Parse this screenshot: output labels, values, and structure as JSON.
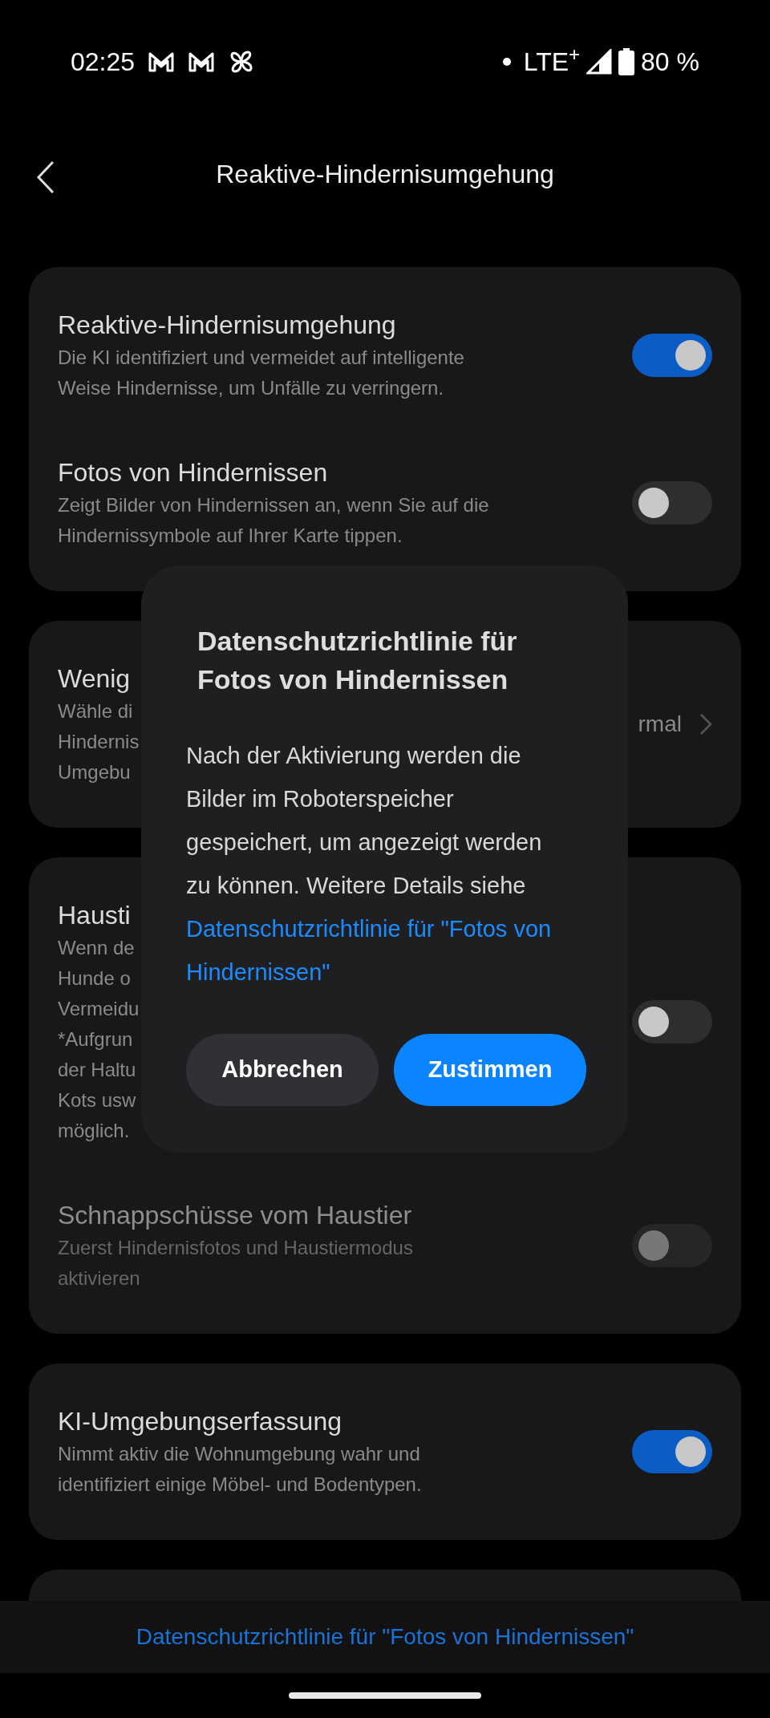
{
  "status_bar": {
    "time": "02:25",
    "network": "LTE$^{+}$",
    "battery": "80 %"
  },
  "header": {
    "title": "Reaktive-Hindernisumgehung"
  },
  "cards": [
    {
      "rows": [
        {
          "kind": "toggle",
          "title": "Reaktive-Hindernisumgehung",
          "description_lines": [
            "Die KI identifiziert und vermeidet auf intelligente",
            "Weise Hindernisse, um Unfälle zu verringern."
          ],
          "on": true,
          "disabled": false
        },
        {
          "kind": "toggle",
          "title": "Fotos von Hindernissen",
          "description_lines": [
            "Zeigt Bilder von Hindernissen an, wenn Sie auf die",
            "Hindernissymbole auf Ihrer Karte tippen."
          ],
          "on": false,
          "disabled": false
        }
      ]
    },
    {
      "rows": [
        {
          "kind": "value",
          "title": "Wenig",
          "description_lines": [
            "Wähle di",
            "Hindernis",
            "Umgebu"
          ],
          "value": "rmal"
        }
      ]
    },
    {
      "rows": [
        {
          "kind": "toggle",
          "title": "Hausti",
          "description_lines": [
            "Wenn de",
            "Hunde o",
            "Vermeidu",
            "*Aufgrun",
            "der Haltu",
            "Kots usw",
            "möglich."
          ],
          "on": false,
          "disabled": false
        },
        {
          "kind": "toggle",
          "title": "Schnappschüsse vom Haustier",
          "description_lines": [
            "Zuerst Hindernisfotos und Haustiermodus",
            "aktivieren"
          ],
          "on": false,
          "disabled": true
        }
      ]
    },
    {
      "rows": [
        {
          "kind": "toggle",
          "title": "KI-Umgebungserfassung",
          "description_lines": [
            "Nimmt aktiv die Wohnumgebung wahr und",
            "identifiziert einige Möbel- und Bodentypen."
          ],
          "on": true,
          "disabled": false
        }
      ]
    }
  ],
  "dialog": {
    "title": "Datenschutzrichtlinie für Fotos von Hindernissen",
    "body": "Nach der Aktivierung werden die Bilder im Roboterspeicher gespeichert, um angezeigt werden zu können. Weitere Details siehe",
    "link": "Datenschutzrichtlinie für \"Fotos von Hindernissen\"",
    "buttons": [
      {
        "label": "Abbrechen",
        "kind": "secondary"
      },
      {
        "label": "Zustimmen",
        "kind": "primary"
      }
    ]
  },
  "footer_link": "Datenschutzrichtlinie für \"Fotos von Hindernissen\""
}
